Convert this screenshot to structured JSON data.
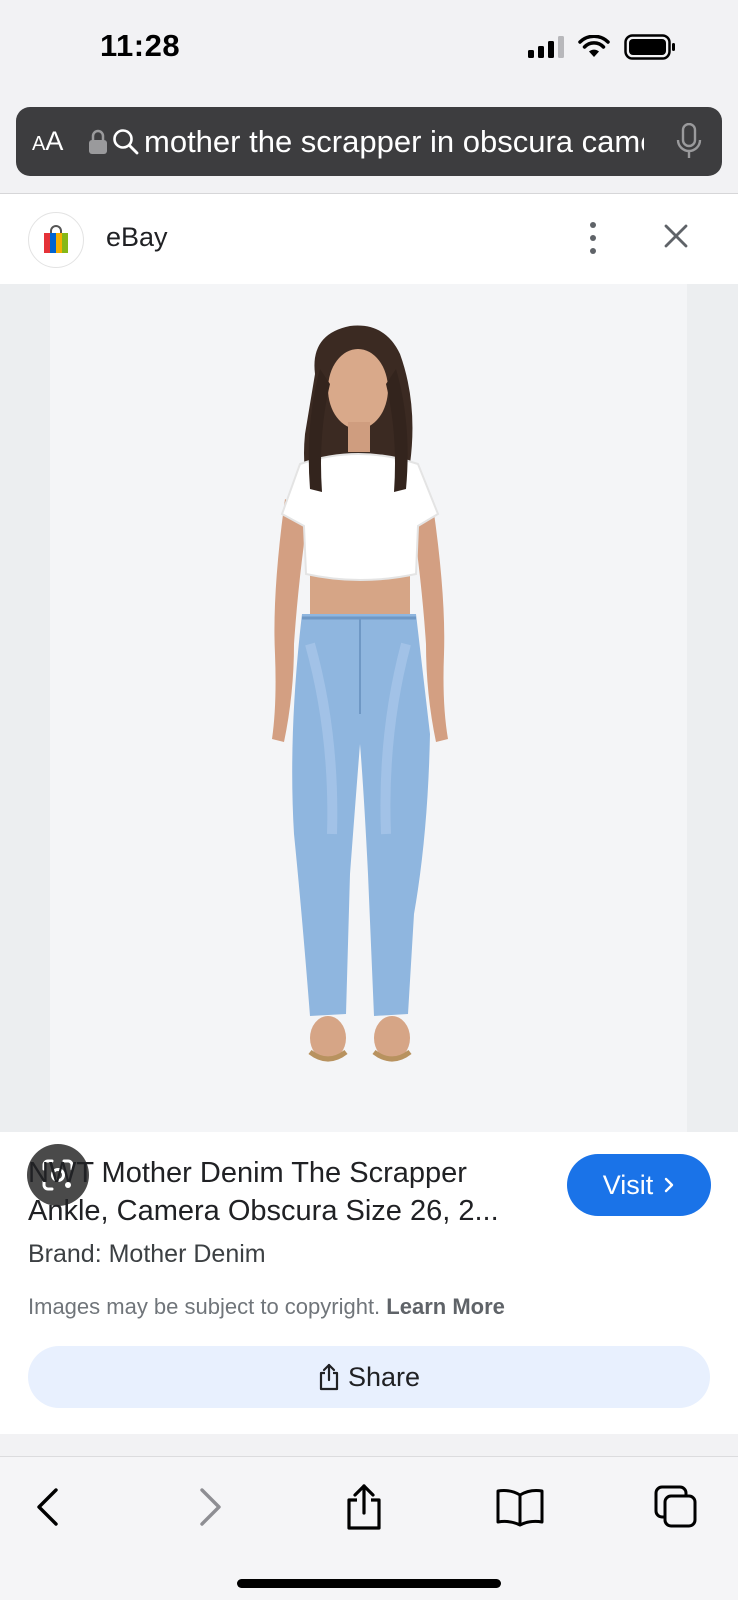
{
  "status_bar": {
    "time": "11:28"
  },
  "address_bar": {
    "aa_label_small": "A",
    "aa_label_large": "A",
    "query": "mother the scrapper in obscura camera"
  },
  "result_panel": {
    "site_name": "eBay",
    "title": "NWT Mother Denim The Scrapper Ankle, Camera Obscura Size 26, 2...",
    "visit_label": "Visit",
    "brand": "Brand: Mother Denim",
    "copyright_text": "Images may be subject to copyright.",
    "learn_more": "Learn More",
    "share_label": "Share"
  },
  "icons": [
    "lock-icon",
    "search-icon",
    "mic-icon",
    "more-icon",
    "close-icon",
    "lens-icon",
    "share-icon",
    "back-icon",
    "forward-icon",
    "bookmarks-icon",
    "tabs-icon"
  ],
  "colors": {
    "accent": "#1a73e8",
    "share_bg": "#e8f0fe",
    "address_bar": "#3d3d3f"
  }
}
